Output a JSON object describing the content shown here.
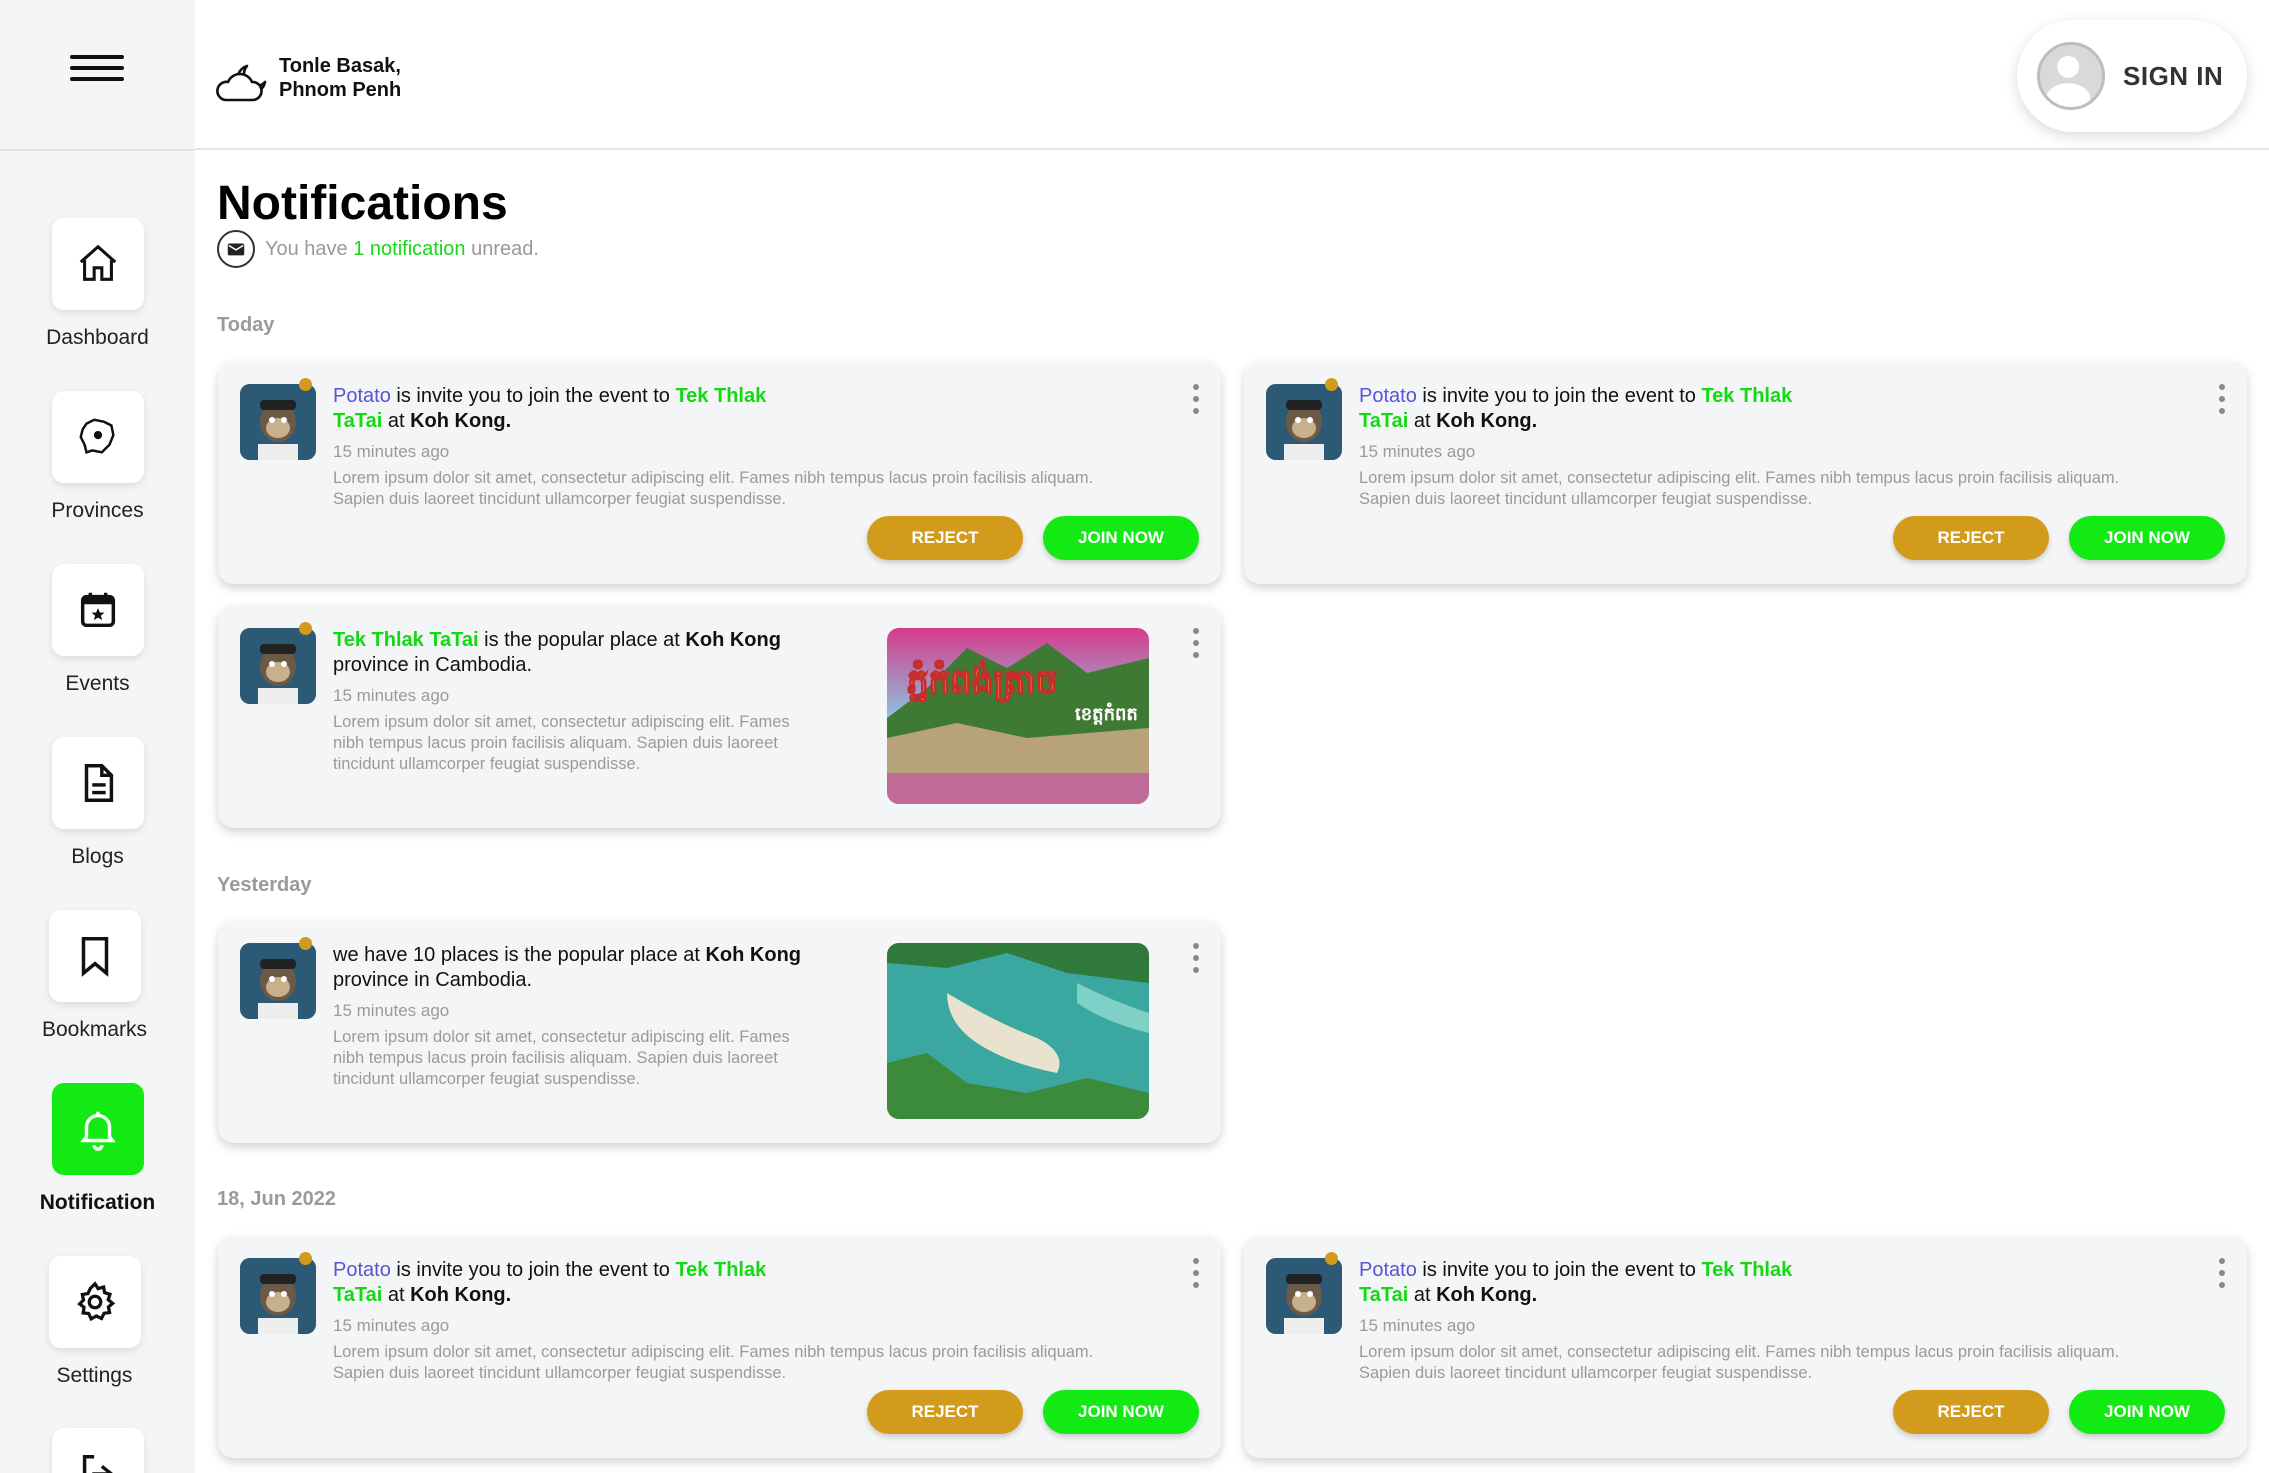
{
  "sidebar": {
    "items": [
      {
        "label": "Dashboard"
      },
      {
        "label": "Provinces"
      },
      {
        "label": "Events"
      },
      {
        "label": "Blogs"
      },
      {
        "label": "Bookmarks"
      },
      {
        "label": "Notification"
      },
      {
        "label": "Settings"
      }
    ],
    "active": "Notification"
  },
  "header": {
    "location_line1": "Tonle Basak,",
    "location_line2": "Phnom Penh",
    "signin_label": "SIGN IN"
  },
  "main": {
    "title": "Notifications",
    "unread": {
      "prefix": "You have",
      "highlight": "1 notification",
      "suffix": "unread."
    },
    "sections": [
      "Today",
      "Yesterday",
      "18, Jun 2022"
    ]
  },
  "notifications": {
    "invite": {
      "user": "Potato",
      "text1": "is invite you to join the event to",
      "event_part1": "Tek Thlak",
      "event_part2": "TaTai",
      "text2": "at",
      "place": "Koh Kong.",
      "time": "15 minutes ago",
      "desc_line1": "Lorem ipsum dolor sit amet, consectetur adipiscing elit. Fames nibh tempus lacus proin facilisis aliquam.",
      "desc_line2": "Sapien duis laoreet tincidunt ullamcorper feugiat suspendisse.",
      "reject_label": "REJECT",
      "join_label": "JOIN NOW"
    },
    "popular": {
      "place_name": "Tek Thlak TaTai",
      "text1": "is the popular place at",
      "place": "Koh Kong",
      "text2": "province in Cambodia.",
      "time": "15 minutes ago",
      "desc_line1": "Lorem ipsum dolor sit amet, consectetur adipiscing elit. Fames",
      "desc_line2": "nibh tempus lacus proin facilisis aliquam. Sapien duis laoreet",
      "desc_line3": "tincidunt ullamcorper feugiat suspendisse.",
      "image_title": "ភ្នំកំពង់ត្រាច",
      "image_subtitle": "ខេត្តកំពត"
    },
    "places": {
      "text1": "we have 10 places is the popular place at",
      "place": "Koh Kong",
      "text2": "province in Cambodia.",
      "time": "15 minutes ago",
      "desc_line1": "Lorem ipsum dolor sit amet, consectetur adipiscing elit. Fames",
      "desc_line2": "nibh tempus lacus proin facilisis aliquam. Sapien duis laoreet",
      "desc_line3": "tincidunt ullamcorper feugiat suspendisse."
    }
  },
  "colors": {
    "accent_green": "#13ea13",
    "reject_gold": "#d39b1b",
    "user_purple": "#5854d6"
  }
}
